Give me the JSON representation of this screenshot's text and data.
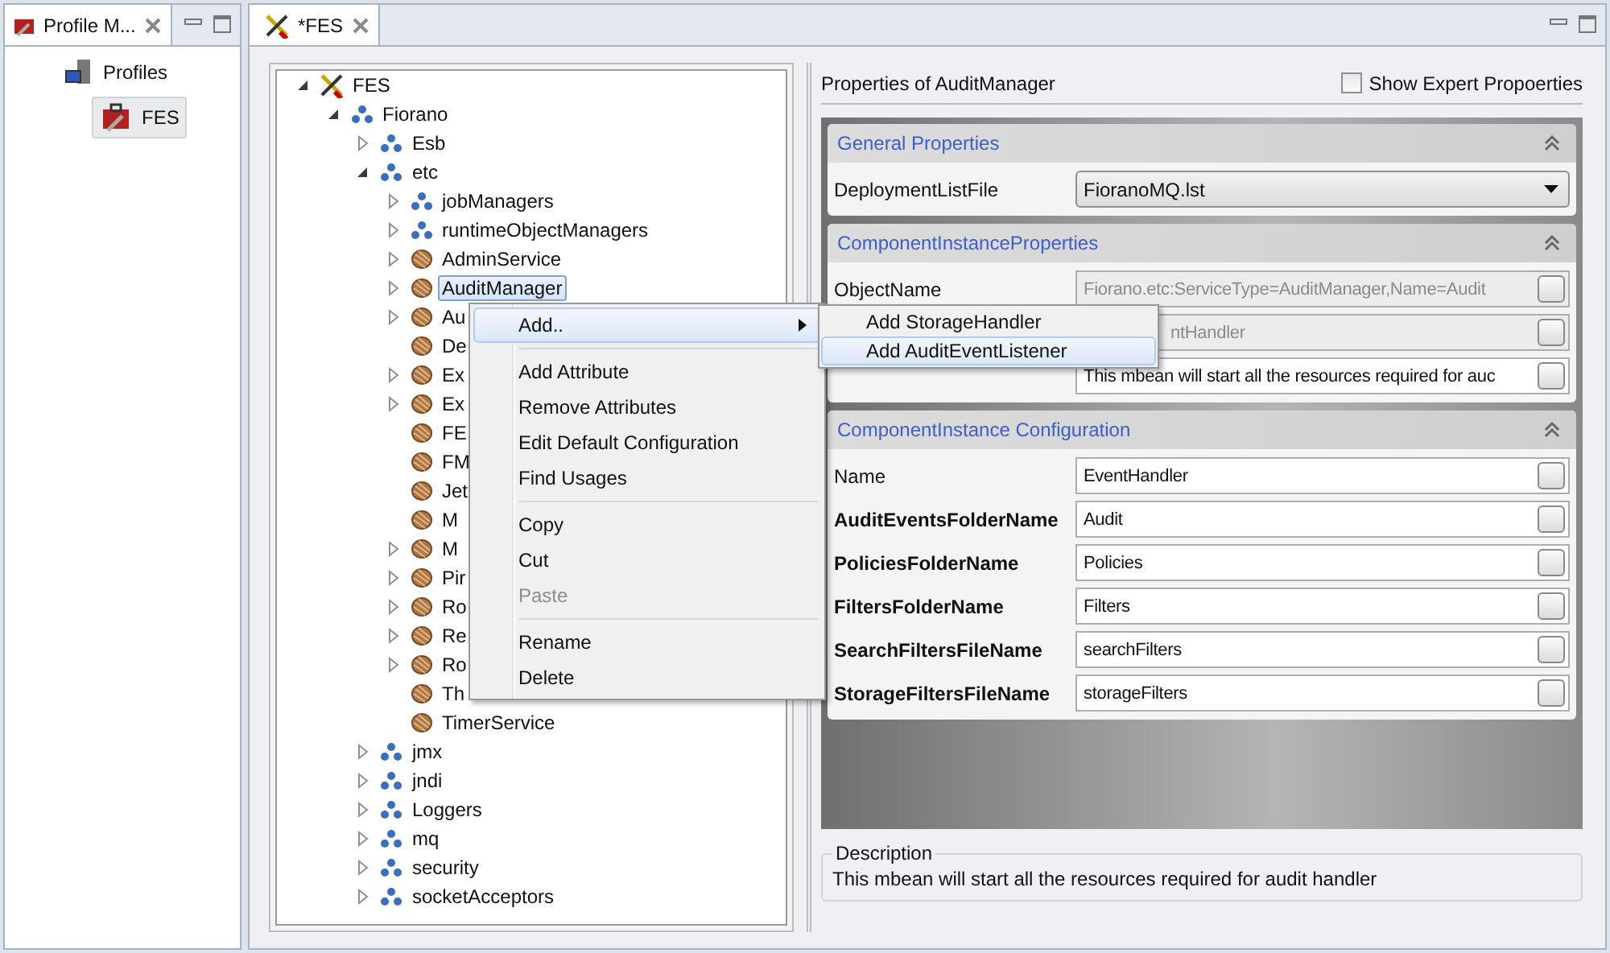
{
  "profiles_view": {
    "tab": {
      "title": "Profile M..."
    },
    "tree": [
      {
        "label": "Profiles",
        "selected": false,
        "children": [
          {
            "label": "FES",
            "selected": true
          }
        ]
      }
    ]
  },
  "editor": {
    "tab": {
      "title": "*FES"
    },
    "tree": [
      {
        "name": "FES",
        "kind": "root",
        "expanded": true,
        "selected": false,
        "children": [
          {
            "name": "Fiorano",
            "kind": "package",
            "expanded": true,
            "selected": false,
            "children": [
              {
                "name": "Esb",
                "kind": "package",
                "expanded": false,
                "selected": false
              },
              {
                "name": "etc",
                "kind": "package",
                "expanded": true,
                "selected": false,
                "children": [
                  {
                    "name": "jobManagers",
                    "kind": "package",
                    "expanded": false,
                    "selected": false
                  },
                  {
                    "name": "runtimeObjectManagers",
                    "kind": "package",
                    "expanded": false,
                    "selected": false
                  },
                  {
                    "name": "AdminService",
                    "kind": "bean",
                    "expanded": false,
                    "selected": false
                  },
                  {
                    "name": "AuditManager",
                    "kind": "bean",
                    "expanded": false,
                    "selected": true
                  },
                  {
                    "name": "Au",
                    "kind": "bean",
                    "expanded": false,
                    "selected": false
                  },
                  {
                    "name": "De",
                    "kind": "bean",
                    "selected": false
                  },
                  {
                    "name": "Ex",
                    "kind": "bean",
                    "expanded": false,
                    "selected": false
                  },
                  {
                    "name": "Ex",
                    "kind": "bean",
                    "expanded": false,
                    "selected": false
                  },
                  {
                    "name": "FE",
                    "kind": "bean",
                    "selected": false
                  },
                  {
                    "name": "FM",
                    "kind": "bean",
                    "selected": false
                  },
                  {
                    "name": "Jet",
                    "kind": "bean",
                    "selected": false
                  },
                  {
                    "name": "M",
                    "kind": "bean",
                    "selected": false
                  },
                  {
                    "name": "M",
                    "kind": "bean",
                    "expanded": false,
                    "selected": false
                  },
                  {
                    "name": "Pir",
                    "kind": "bean",
                    "expanded": false,
                    "selected": false
                  },
                  {
                    "name": "Ro",
                    "kind": "bean",
                    "expanded": false,
                    "selected": false
                  },
                  {
                    "name": "Re",
                    "kind": "bean",
                    "expanded": false,
                    "selected": false
                  },
                  {
                    "name": "Ro",
                    "kind": "bean",
                    "expanded": false,
                    "selected": false
                  },
                  {
                    "name": "Th",
                    "kind": "bean",
                    "selected": false
                  },
                  {
                    "name": "TimerService",
                    "kind": "bean",
                    "selected": false
                  }
                ]
              },
              {
                "name": "jmx",
                "kind": "package",
                "expanded": false,
                "selected": false
              },
              {
                "name": "jndi",
                "kind": "package",
                "expanded": false,
                "selected": false
              },
              {
                "name": "Loggers",
                "kind": "package",
                "expanded": false,
                "selected": false
              },
              {
                "name": "mq",
                "kind": "package",
                "expanded": false,
                "selected": false
              },
              {
                "name": "security",
                "kind": "package",
                "expanded": false,
                "selected": false
              },
              {
                "name": "socketAcceptors",
                "kind": "package",
                "expanded": false,
                "selected": false
              }
            ]
          }
        ]
      }
    ],
    "properties": {
      "title": "Properties of AuditManager",
      "expert_toggle": {
        "label": "Show Expert Propoerties",
        "checked": false
      },
      "sections": [
        {
          "title": "General Properties",
          "rows": [
            {
              "label": "DeploymentListFile",
              "kind": "dropdown",
              "value": "FioranoMQ.lst",
              "bold": false,
              "disabled": false
            }
          ]
        },
        {
          "title": "ComponentInstanceProperties",
          "rows": [
            {
              "label": "ObjectName",
              "kind": "text",
              "value": "Fiorano.etc:ServiceType=AuditManager,Name=Audit",
              "bold": false,
              "disabled": true
            },
            {
              "kind": "text",
              "value": "ntHandler",
              "disabled": true
            },
            {
              "kind": "text",
              "value": "This mbean will start all the resources required for auc",
              "disabled": false
            }
          ]
        },
        {
          "title": "ComponentInstance Configuration",
          "rows": [
            {
              "label": "Name",
              "kind": "text",
              "value": "EventHandler",
              "bold": false,
              "disabled": false
            },
            {
              "label": "AuditEventsFolderName",
              "kind": "text",
              "value": "Audit",
              "bold": true,
              "disabled": false
            },
            {
              "label": "PoliciesFolderName",
              "kind": "text",
              "value": "Policies",
              "bold": true,
              "disabled": false
            },
            {
              "label": "FiltersFolderName",
              "kind": "text",
              "value": "Filters",
              "bold": true,
              "disabled": false
            },
            {
              "label": "SearchFiltersFileName",
              "kind": "text",
              "value": "searchFilters",
              "bold": true,
              "disabled": false
            },
            {
              "label": "StorageFiltersFileName",
              "kind": "text",
              "value": "storageFilters",
              "bold": true,
              "disabled": false
            }
          ]
        }
      ],
      "description": {
        "title": "Description",
        "text": "This mbean will start all the resources required for audit handler"
      }
    }
  },
  "context_menu": {
    "items": [
      {
        "kind": "item",
        "label": "Add..",
        "submenu": true,
        "selected": true,
        "disabled": false
      },
      {
        "kind": "separator"
      },
      {
        "kind": "item",
        "label": "Add Attribute",
        "submenu": false,
        "selected": false,
        "disabled": false
      },
      {
        "kind": "item",
        "label": "Remove Attributes",
        "submenu": false,
        "selected": false,
        "disabled": false
      },
      {
        "kind": "item",
        "label": "Edit Default Configuration",
        "submenu": false,
        "selected": false,
        "disabled": false
      },
      {
        "kind": "item",
        "label": "Find Usages",
        "submenu": false,
        "selected": false,
        "disabled": false
      },
      {
        "kind": "separator"
      },
      {
        "kind": "item",
        "label": "Copy",
        "submenu": false,
        "selected": false,
        "disabled": false
      },
      {
        "kind": "item",
        "label": "Cut",
        "submenu": false,
        "selected": false,
        "disabled": false
      },
      {
        "kind": "item",
        "label": "Paste",
        "submenu": false,
        "selected": false,
        "disabled": true
      },
      {
        "kind": "separator"
      },
      {
        "kind": "item",
        "label": "Rename",
        "submenu": false,
        "selected": false,
        "disabled": false
      },
      {
        "kind": "item",
        "label": "Delete",
        "submenu": false,
        "selected": false,
        "disabled": false
      }
    ],
    "submenu": [
      {
        "label": "Add StorageHandler",
        "selected": false
      },
      {
        "label": "Add AuditEventListener",
        "selected": true
      }
    ]
  }
}
